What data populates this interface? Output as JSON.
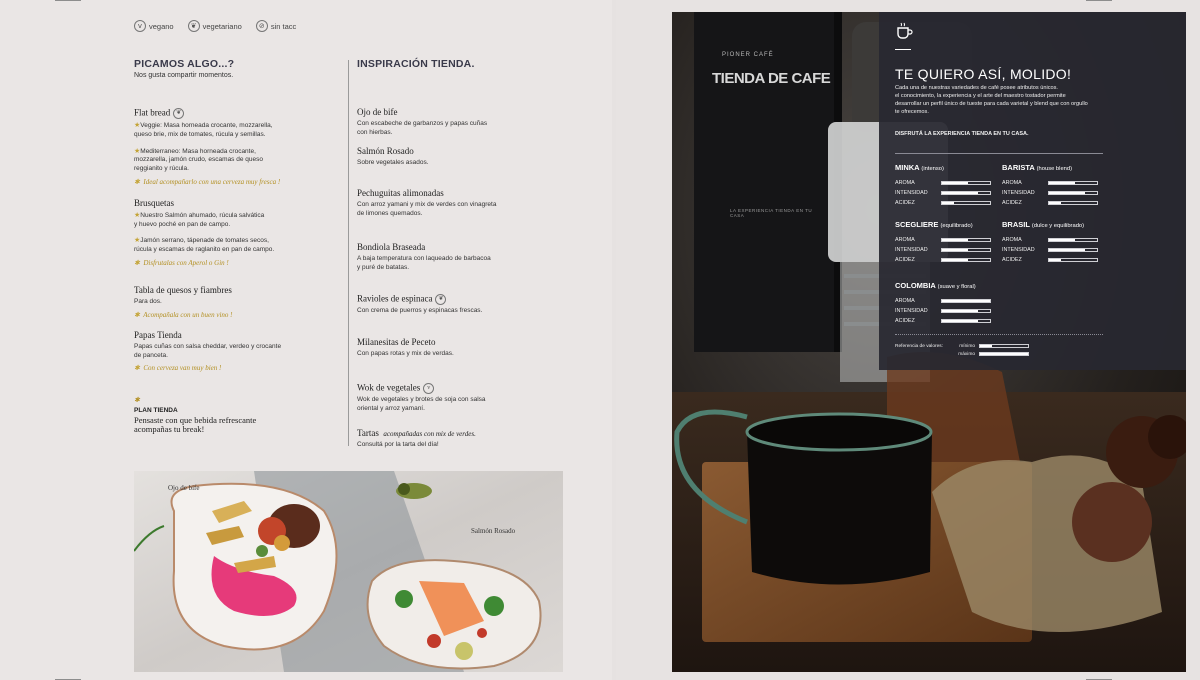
{
  "legend": {
    "vegan": "vegano",
    "vegetarian": "vegetariano",
    "gluten_free": "sin tacc"
  },
  "left_column": {
    "title": "PICAMOS ALGO...?",
    "subtitle": "Nos gusta compartir momentos.",
    "dishes": [
      {
        "name": "Flat bread",
        "lines": [
          "Veggie: Masa horneada crocante, mozzarella,",
          "queso brie, mix de tomates, rúcula y semillas.",
          "Mediterraneo: Masa horneada crocante,",
          "mozzarella, jamón crudo, escamas de queso",
          "reggianito y rúcula."
        ],
        "hint": "Ideal acompañarlo con una cerveza muy fresca !"
      },
      {
        "name": "Brusquetas",
        "lines": [
          "Nuestro Salmón ahumado, rúcula salvática",
          "y huevo poché en pan de campo.",
          "Jamón serrano, tápenade de tomates secos,",
          "rúcula y escamas de raglanito en pan de campo."
        ],
        "hint": "Disfrutalas con Aperol o Gin !"
      },
      {
        "name": "Tabla de quesos y fiambres",
        "lines": [
          "Para dos."
        ],
        "hint": "Acompañala con un buen vino !"
      },
      {
        "name": "Papas Tienda",
        "lines": [
          "Papas cuñas con salsa cheddar, verdeo y crocante",
          "de panceta."
        ],
        "hint": "Con cerveza van muy bien !"
      }
    ],
    "plan": {
      "title": "PLAN TIENDA",
      "lines": [
        "Pensaste con que bebida refrescante",
        "acompañas tu break!"
      ]
    }
  },
  "mid_column": {
    "title": "INSPIRACIÓN TIENDA.",
    "dishes": [
      {
        "name": "Ojo de bife",
        "lines": [
          "Con escabeche de garbanzos y papas cuñas",
          "con hierbas."
        ]
      },
      {
        "name": "Salmón Rosado",
        "lines": [
          "Sobre vegetales asados."
        ]
      },
      {
        "name": "Pechuguitas alimonadas",
        "lines": [
          "Con arroz yamani y mix de verdes con vinagreta",
          "de limones quemados."
        ]
      },
      {
        "name": "Bondiola Braseada",
        "lines": [
          "A baja temperatura con laqueado de barbacoa",
          "y puré de batatas."
        ]
      },
      {
        "name": "Ravioles de espinaca",
        "lines": [
          "Con crema de puerros y espinacas frescas."
        ]
      },
      {
        "name": "Milanesitas de Peceto",
        "lines": [
          "Con papas rotas y mix de verdas."
        ]
      },
      {
        "name": "Wok de vegetales",
        "lines": [
          "Wok de vegetales y brotes de soja con salsa",
          "oriental y arroz yamaní."
        ]
      },
      {
        "name": "Tartas",
        "name_extra": "acompañadas con mix de verdes.",
        "lines": [
          "Consultá por la tarta del día!"
        ]
      }
    ]
  },
  "food_photo": {
    "label_1": "Ojo de bife",
    "label_2": "Salmón Rosado"
  },
  "coffee_photo": {
    "package_brand": "TIENDA DE CAFE",
    "package_small": "PIONER CAFÉ",
    "package_tagline": "LA EXPERIENCIA TIENDA EN TU CASA"
  },
  "panel": {
    "title": "TE QUIERO ASÍ, MOLIDO!",
    "text": [
      "Cada una de nuestras variedades de café posee atributos únicos.",
      "el conocimiento, la experiencia y el arte del maestro tostador permite",
      "desarrollar un perfil único de tueste para cada varietal y blend que con orgullo",
      "te ofrecemos."
    ],
    "cta": "DISFRUTÁ LA EXPERIENCIA TIENDA EN TU CASA.",
    "attr_labels": [
      "AROMA",
      "INTENSIDAD",
      "ACIDEZ"
    ],
    "blends": [
      {
        "name": "MINKA",
        "note": "(intenso)",
        "values": [
          0.55,
          0.75,
          0.25
        ]
      },
      {
        "name": "BARISTA",
        "note": "(house blend)",
        "values": [
          0.55,
          0.75,
          0.25
        ]
      },
      {
        "name": "SCEGLIERE",
        "note": "(equilibrado)",
        "values": [
          0.55,
          0.55,
          0.55
        ]
      },
      {
        "name": "BRASIL",
        "note": "(dulce y equilibrado)",
        "values": [
          0.55,
          0.75,
          0.25
        ]
      },
      {
        "name": "COLOMBIA",
        "note": "(suave y floral)",
        "values": [
          1.0,
          0.75,
          0.75
        ]
      }
    ],
    "reference": {
      "label": "Referencia de valores:",
      "min_label": "mínimo",
      "min_value": 0.25,
      "max_label": "máximo",
      "max_value": 1.0
    }
  }
}
